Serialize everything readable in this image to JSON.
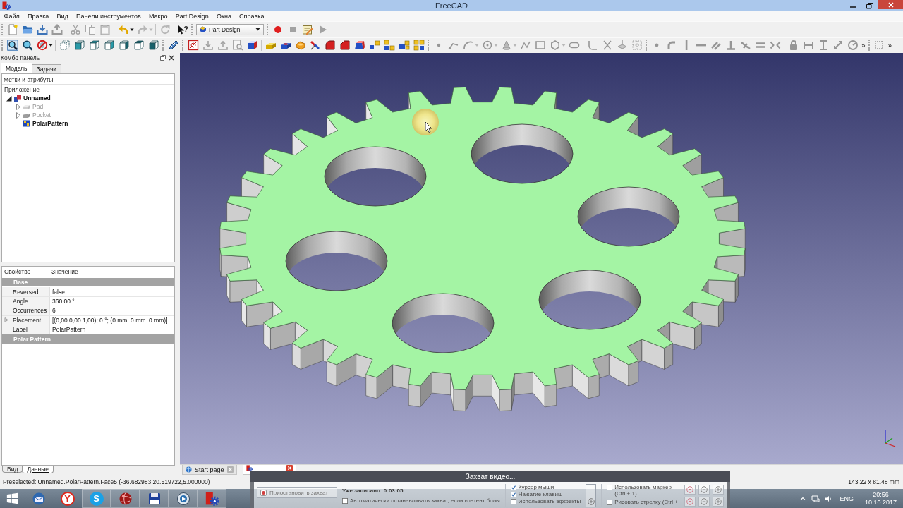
{
  "window": {
    "title": "FreeCAD"
  },
  "menu": [
    "Файл",
    "Правка",
    "Вид",
    "Панели инструментов",
    "Макро",
    "Part Design",
    "Окна",
    "Справка"
  ],
  "toolbars": [
    {
      "items": [
        {
          "kind": "grip"
        },
        {
          "kind": "new",
          "disabled": false
        },
        {
          "kind": "open",
          "disabled": false
        },
        {
          "kind": "save",
          "disabled": false
        },
        {
          "kind": "save_as",
          "disabled": false
        },
        {
          "kind": "sep"
        },
        {
          "kind": "cut",
          "disabled": true
        },
        {
          "kind": "copy",
          "disabled": true
        },
        {
          "kind": "paste",
          "disabled": true
        },
        {
          "kind": "sep"
        },
        {
          "kind": "undo",
          "disabled": false
        },
        {
          "kind": "caret",
          "disabled": false
        },
        {
          "kind": "redo",
          "disabled": true
        },
        {
          "kind": "caret",
          "disabled": true
        },
        {
          "kind": "sep"
        },
        {
          "kind": "refresh",
          "disabled": true
        },
        {
          "kind": "sep"
        },
        {
          "kind": "whats_this",
          "glyph": "?",
          "disabled": false
        },
        {
          "kind": "grip"
        },
        {
          "kind": "workbench",
          "value": "Part Design"
        },
        {
          "kind": "grip"
        },
        {
          "kind": "record",
          "disabled": false
        },
        {
          "kind": "stop",
          "disabled": true
        },
        {
          "kind": "macro_edit",
          "disabled": false
        },
        {
          "kind": "play",
          "disabled": true
        }
      ]
    },
    {
      "items": [
        {
          "kind": "grip"
        },
        {
          "kind": "fit_all",
          "disabled": false
        },
        {
          "kind": "fit_selection",
          "disabled": false
        },
        {
          "kind": "draw_style",
          "disabled": false
        },
        {
          "kind": "caret",
          "disabled": false
        },
        {
          "kind": "sep"
        },
        {
          "kind": "view_iso",
          "disabled": false
        },
        {
          "kind": "view_front",
          "disabled": false
        },
        {
          "kind": "view_top",
          "disabled": false
        },
        {
          "kind": "view_right",
          "disabled": false
        },
        {
          "kind": "view_rear",
          "disabled": false
        },
        {
          "kind": "view_bottom",
          "disabled": false
        },
        {
          "kind": "view_left",
          "disabled": false
        },
        {
          "kind": "grip"
        },
        {
          "kind": "measure",
          "disabled": false
        },
        {
          "kind": "grip"
        },
        {
          "kind": "sketch",
          "disabled": false
        },
        {
          "kind": "import",
          "disabled": true
        },
        {
          "kind": "export",
          "disabled": true
        },
        {
          "kind": "doc_search",
          "disabled": true
        },
        {
          "kind": "binder",
          "disabled": false
        },
        {
          "kind": "sep"
        },
        {
          "kind": "pad",
          "disabled": false
        },
        {
          "kind": "pocket",
          "disabled": false
        },
        {
          "kind": "revolution",
          "disabled": false
        },
        {
          "kind": "mirror",
          "disabled": false
        },
        {
          "kind": "fillet",
          "disabled": false
        },
        {
          "kind": "chamfer",
          "disabled": false
        },
        {
          "kind": "draft",
          "disabled": false
        },
        {
          "kind": "pattern_linear",
          "disabled": false
        },
        {
          "kind": "pattern_polar",
          "disabled": false
        },
        {
          "kind": "pattern_scaled",
          "disabled": false
        },
        {
          "kind": "pattern_multi",
          "disabled": false
        },
        {
          "kind": "grip"
        },
        {
          "kind": "s_point",
          "disabled": true
        },
        {
          "kind": "s_line",
          "disabled": true
        },
        {
          "kind": "s_arc",
          "disabled": true
        },
        {
          "kind": "caret",
          "disabled": true
        },
        {
          "kind": "s_circle",
          "disabled": true
        },
        {
          "kind": "caret",
          "disabled": true
        },
        {
          "kind": "s_conic",
          "disabled": true
        },
        {
          "kind": "caret",
          "disabled": true
        },
        {
          "kind": "s_polyline",
          "disabled": true
        },
        {
          "kind": "s_rect",
          "disabled": true
        },
        {
          "kind": "s_polygon",
          "disabled": true
        },
        {
          "kind": "caret",
          "disabled": true
        },
        {
          "kind": "s_slot",
          "disabled": true
        },
        {
          "kind": "sep"
        },
        {
          "kind": "s_fillet",
          "disabled": true
        },
        {
          "kind": "s_trim",
          "disabled": true
        },
        {
          "kind": "s_external",
          "disabled": true
        },
        {
          "kind": "s_construction",
          "disabled": true
        },
        {
          "kind": "grip"
        },
        {
          "kind": "c_coincident",
          "disabled": true
        },
        {
          "kind": "c_tangent_arc",
          "disabled": true
        },
        {
          "kind": "c_vertical",
          "disabled": true
        },
        {
          "kind": "c_horizontal",
          "disabled": true
        },
        {
          "kind": "c_parallel",
          "disabled": true
        },
        {
          "kind": "c_perpendicular",
          "disabled": true
        },
        {
          "kind": "c_tangent",
          "disabled": true
        },
        {
          "kind": "c_equal",
          "disabled": true
        },
        {
          "kind": "c_symmetric",
          "disabled": true
        },
        {
          "kind": "sep"
        },
        {
          "kind": "c_lock",
          "disabled": true
        },
        {
          "kind": "c_hdist",
          "disabled": true
        },
        {
          "kind": "c_vdist",
          "disabled": true
        },
        {
          "kind": "c_distance",
          "disabled": true
        },
        {
          "kind": "c_radius",
          "disabled": true
        },
        {
          "kind": "more",
          "glyph": "»"
        },
        {
          "kind": "grip"
        },
        {
          "kind": "grid_toggle",
          "disabled": true
        },
        {
          "kind": "more",
          "glyph": "»"
        }
      ]
    }
  ],
  "combo_panel": {
    "title": "Комбо панель",
    "tabs": [
      {
        "label": "Модель",
        "selected": true
      },
      {
        "label": "Задачи",
        "selected": false
      }
    ]
  },
  "tree": {
    "header": "Метки и атрибуты",
    "root": "Приложение",
    "items": [
      {
        "label": "Unnamed",
        "kind": "document",
        "expandable": true,
        "expanded": true,
        "visible": true,
        "children": [
          {
            "label": "Pad",
            "kind": "pad",
            "expandable": true,
            "expanded": false,
            "visible": false,
            "tip": false
          },
          {
            "label": "Pocket",
            "kind": "pocket",
            "expandable": true,
            "expanded": false,
            "visible": false,
            "tip": false
          },
          {
            "label": "PolarPattern",
            "kind": "pattern",
            "expandable": false,
            "expanded": false,
            "visible": true,
            "tip": true
          }
        ]
      }
    ]
  },
  "properties": {
    "columns": [
      "Свойство",
      "Значение"
    ],
    "rows": [
      {
        "kind": "group",
        "label": "Base"
      },
      {
        "kind": "property",
        "name": "Reversed",
        "value": "false",
        "expandable": false
      },
      {
        "kind": "property",
        "name": "Angle",
        "value": "360,00 °",
        "expandable": false
      },
      {
        "kind": "property",
        "name": "Occurrences",
        "value": "6",
        "expandable": false
      },
      {
        "kind": "property",
        "name": "Placement",
        "value": "[(0,00 0,00 1,00); 0 °; (0 mm  0 mm  0 mm)]",
        "expandable": true
      },
      {
        "kind": "property",
        "name": "Label",
        "value": "PolarPattern",
        "expandable": false
      },
      {
        "kind": "group",
        "label": "Polar Pattern"
      }
    ]
  },
  "panel_tabs": [
    {
      "label": "Вид",
      "selected": false
    },
    {
      "label": "Данные",
      "selected": true
    }
  ],
  "document_tabs": [
    {
      "kind": "web",
      "label": "Start page",
      "selected": false
    },
    {
      "kind": "document",
      "selected": true
    }
  ],
  "status_bar": {
    "message": "Preselected: Unnamed.PolarPattern.Face5 (-36.682983,20.519722,5.000000)",
    "dimensions": "143.22 x 81.48 mm"
  },
  "taskbar": {
    "apps": [
      {
        "kind": "mail",
        "running": false
      },
      {
        "kind": "letter",
        "glyph": "Y",
        "running": false
      },
      {
        "kind": "chat",
        "glyph": "S",
        "running": true
      },
      {
        "kind": "globe",
        "running": true
      },
      {
        "kind": "floppy",
        "running": true
      },
      {
        "kind": "aperture",
        "running": true
      },
      {
        "kind": "cad",
        "running": true
      }
    ],
    "language": "ENG",
    "time": "20:56",
    "date": "10.10.2017"
  },
  "capture_dialog": {
    "title": "Захват видео...",
    "pause_button": "Приостановить захват",
    "elapsed": "Уже записано: 0:03:05",
    "auto_stop": {
      "label": "Автоматически останавливать захват, если контент болы",
      "checked": false
    },
    "show_options": [
      {
        "label": "Курсор мыши",
        "checked": true
      },
      {
        "label": "Нажатие клавиш",
        "checked": true
      },
      {
        "label": "Использовать эффекты",
        "checked": false
      }
    ],
    "draw_options": [
      {
        "label": "Использовать маркер (Ctrl + 1)",
        "checked": false
      },
      {
        "label": "Рисовать стрелку (Ctrl +",
        "checked": false
      }
    ]
  }
}
